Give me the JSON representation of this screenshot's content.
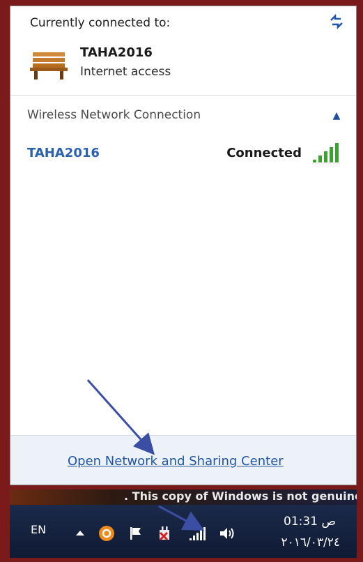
{
  "header": {
    "connected_label": "Currently connected to:"
  },
  "current_network": {
    "name": "TAHA2016",
    "status": "Internet access"
  },
  "wireless_section": {
    "title": "Wireless Network Connection",
    "networks": [
      {
        "name": "TAHA2016",
        "status": "Connected"
      }
    ]
  },
  "footer": {
    "link_label": "Open Network and Sharing Center"
  },
  "watermark": {
    "text": ". This copy of Windows is not genuine"
  },
  "taskbar": {
    "language": "EN",
    "time": "01:31 ص",
    "date": "٢٠١٦/٠٣/٢٤",
    "icons": [
      "show-hidden-icons-icon",
      "app-orange-icon",
      "action-center-flag-icon",
      "power-plug-icon",
      "network-signal-icon",
      "volume-icon"
    ]
  },
  "colors": {
    "link": "#1f56a6",
    "signal": "#3aa52c",
    "frame": "#7a1a1a",
    "annotation_arrow": "#3a4fa3"
  }
}
